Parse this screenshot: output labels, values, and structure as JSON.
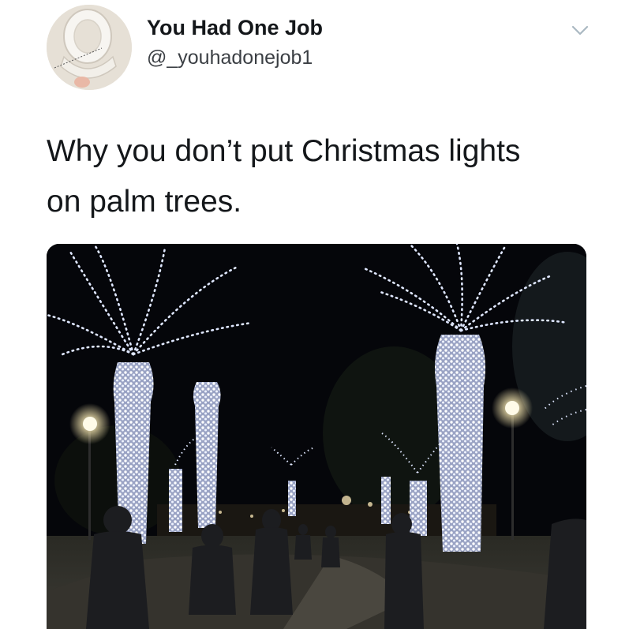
{
  "author": {
    "name": "You Had One Job",
    "handle": "@_youhadonejob1",
    "avatar": "toilet-seat-avatar"
  },
  "menu": {
    "icon": "chevron-down-icon"
  },
  "tweet": {
    "text_line1": "Why you don’t put Christmas lights",
    "text_line2": "on palm trees."
  },
  "media": {
    "subject": "palm-trees-with-christmas-lights-photo"
  },
  "colors": {
    "text": "#14171a",
    "handle": "#3b3f44",
    "chevron": "#aab8c2",
    "lights": "#eef3ff"
  }
}
